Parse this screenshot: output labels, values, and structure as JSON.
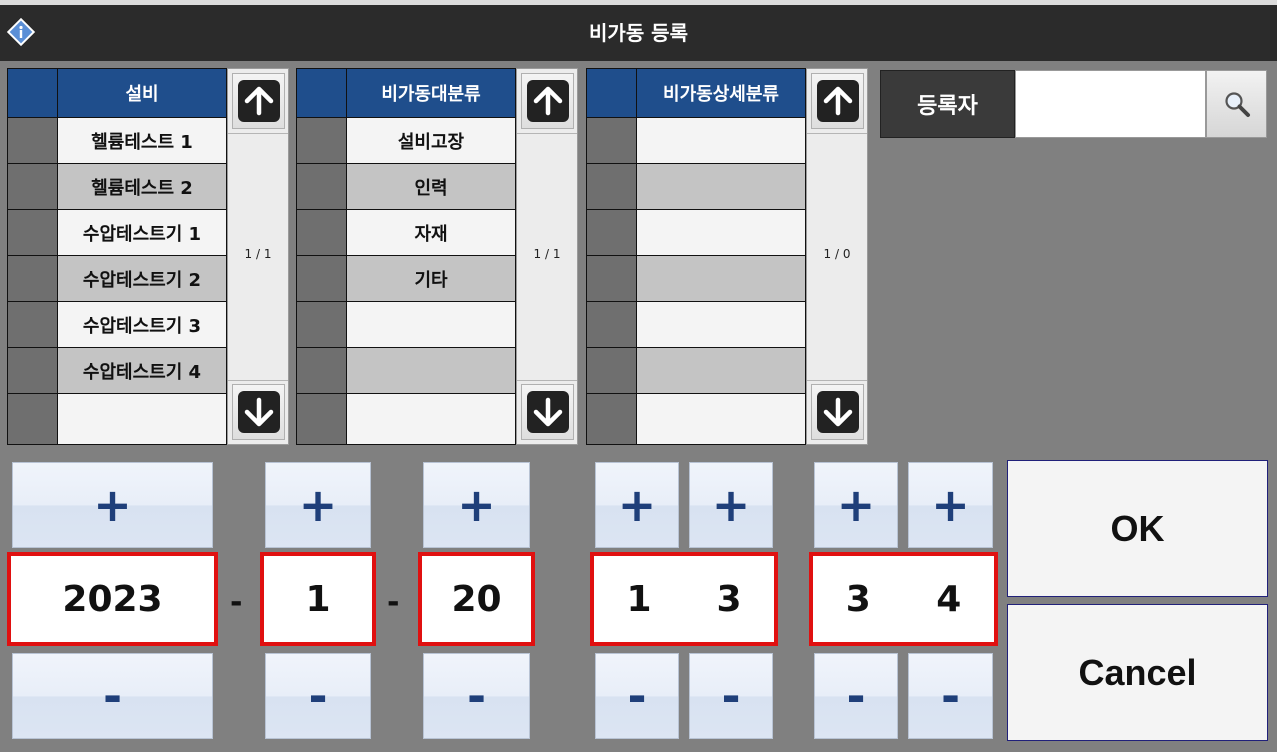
{
  "window": {
    "title": "비가동 등록"
  },
  "equipment": {
    "header": "설비",
    "rows": [
      "헬륨테스트 1",
      "헬륨테스트 2",
      "수압테스트기 1",
      "수압테스트기 2",
      "수압테스트기 3",
      "수압테스트기 4",
      ""
    ],
    "page": "1 / 1"
  },
  "major_category": {
    "header": "비가동대분류",
    "rows": [
      "설비고장",
      "인력",
      "자재",
      "기타",
      "",
      "",
      ""
    ],
    "page": "1 / 1"
  },
  "detail_category": {
    "header": "비가동상세분류",
    "rows": [
      "",
      "",
      "",
      "",
      "",
      "",
      ""
    ],
    "page": "1 / 0"
  },
  "registrant": {
    "label": "등록자",
    "value": ""
  },
  "datetime": {
    "year": "2023",
    "month": "1",
    "day": "20",
    "hour_tens": "1",
    "hour_ones": "3",
    "minute_tens": "3",
    "minute_ones": "4",
    "separator": "-",
    "plus": "+",
    "minus": "-"
  },
  "buttons": {
    "ok": "OK",
    "cancel": "Cancel"
  },
  "icons": [
    "info-icon",
    "arrow-up-icon",
    "arrow-down-icon",
    "search-icon"
  ],
  "colors": {
    "header_blue": "#1f4e8c",
    "value_border": "#e01010",
    "titlebar": "#2b2b2b"
  }
}
